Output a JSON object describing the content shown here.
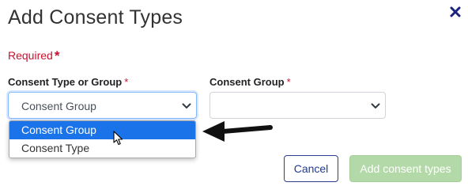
{
  "dialog": {
    "title": "Add Consent Types"
  },
  "required_note": {
    "text": "Required",
    "marker": "*"
  },
  "fields": {
    "consent_type_or_group": {
      "label": "Consent Type or Group",
      "required_marker": "*",
      "value": "Consent Group",
      "options": [
        "Consent Group",
        "Consent Type"
      ],
      "highlighted_option": "Consent Group"
    },
    "consent_group": {
      "label": "Consent Group",
      "required_marker": "*",
      "value": ""
    }
  },
  "buttons": {
    "cancel": "Cancel",
    "add": "Add consent types"
  },
  "icons": {
    "close": "close-icon",
    "chevron": "chevron-down-icon",
    "cursor": "mouse-pointer-icon",
    "annotation": "arrow-left-icon"
  },
  "colors": {
    "required": "#c8102e",
    "close": "#1a237e",
    "highlight": "#1a73e8",
    "add_button": "#b4d9a8",
    "cancel_border": "#2c3e8f"
  }
}
